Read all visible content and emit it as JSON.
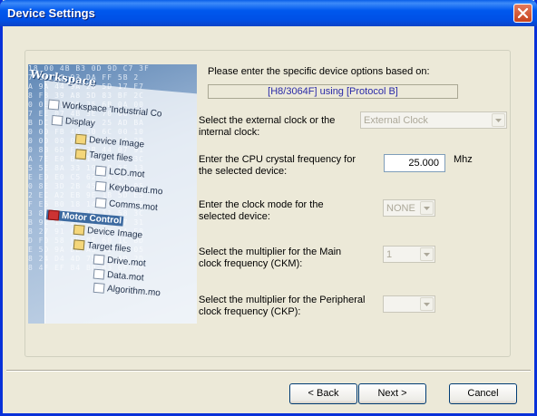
{
  "window": {
    "title": "Device Settings",
    "close_icon": "close-icon"
  },
  "side_image": {
    "workspace_title": "Workspace",
    "items": [
      "Workspace 'Industrial Co",
      "Display",
      "Device Image",
      "Target files",
      "LCD.mot",
      "Keyboard.mo",
      "Comms.mot",
      "Motor Control",
      "Device Image",
      "Target files",
      "Drive.mot",
      "Data.mot",
      "Algorithm.mo"
    ]
  },
  "form": {
    "intro": "Please enter the specific device options based on:",
    "device_banner": "[H8/3064F] using [Protocol B]",
    "clock_source_label": "Select the external clock or the internal clock:",
    "clock_source_value": "External Clock",
    "crystal_label": "Enter the CPU crystal frequency for the selected device:",
    "crystal_value": "25.000",
    "crystal_unit": "Mhz",
    "clock_mode_label": "Enter the clock mode for the selected device:",
    "clock_mode_value": "NONE",
    "ckm_label": "Select the multiplier for the Main clock frequency (CKM):",
    "ckm_value": "1",
    "ckp_label": "Select the multiplier for the Peripheral clock frequency (CKP):",
    "ckp_value": ""
  },
  "buttons": {
    "back": "< Back",
    "next": "Next >",
    "cancel": "Cancel"
  }
}
